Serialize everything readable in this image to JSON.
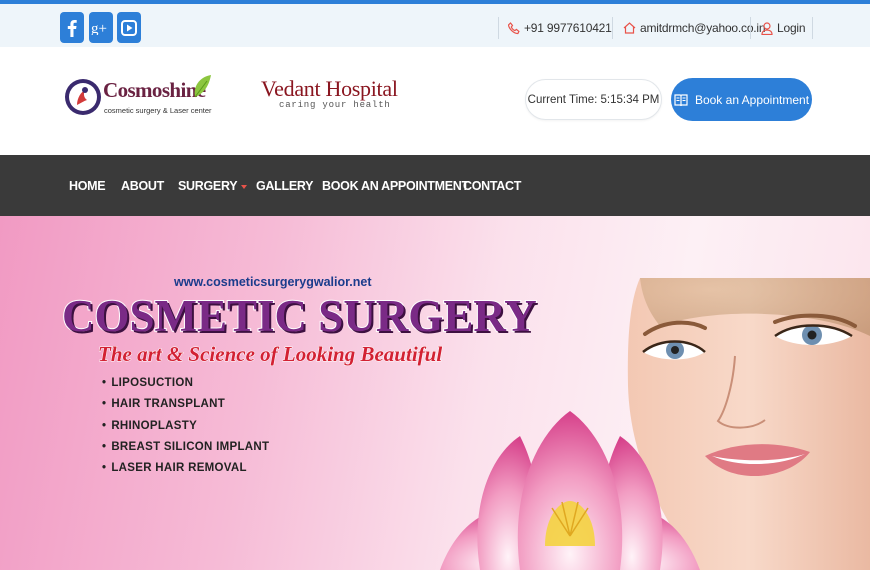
{
  "topbar": {
    "social": [
      {
        "name": "facebook",
        "icon": "facebook-icon",
        "glyph": "f"
      },
      {
        "name": "google-plus",
        "icon": "google-plus-icon",
        "glyph": "g+"
      },
      {
        "name": "youtube",
        "icon": "youtube-icon",
        "glyph": "play"
      }
    ],
    "phone": "+91  9977610421",
    "email": "amitdrmch@yahoo.co.in",
    "login": "Login"
  },
  "header": {
    "logo1_title": "Cosmoshine",
    "logo1_subtitle": "cosmetic surgery & Laser center",
    "logo2_title": "Vedant Hospital",
    "logo2_subtitle": "caring  your  health",
    "time_label": "Current Time:",
    "time_value": "5:15:34 PM",
    "appointment_button": "Book an Appointment"
  },
  "nav": {
    "items": [
      "HOME",
      "ABOUT",
      "SURGERY",
      "GALLERY",
      "BOOK AN APPOINTMENT",
      "CONTACT"
    ]
  },
  "banner": {
    "url": "www.cosmeticsurgerygwalior.net",
    "title": "COSMETIC SURGERY",
    "tagline": "The art & Science of Looking Beautiful",
    "services": [
      "LIPOSUCTION",
      "HAIR TRANSPLANT",
      "RHINOPLASTY",
      "BREAST SILICON IMPLANT",
      "LASER HAIR REMOVAL"
    ]
  },
  "colors": {
    "accent": "#2d7fd8",
    "nav_bg": "#3a3a3a",
    "topbar_bg": "#eef5fa",
    "caret": "#e8534a"
  }
}
